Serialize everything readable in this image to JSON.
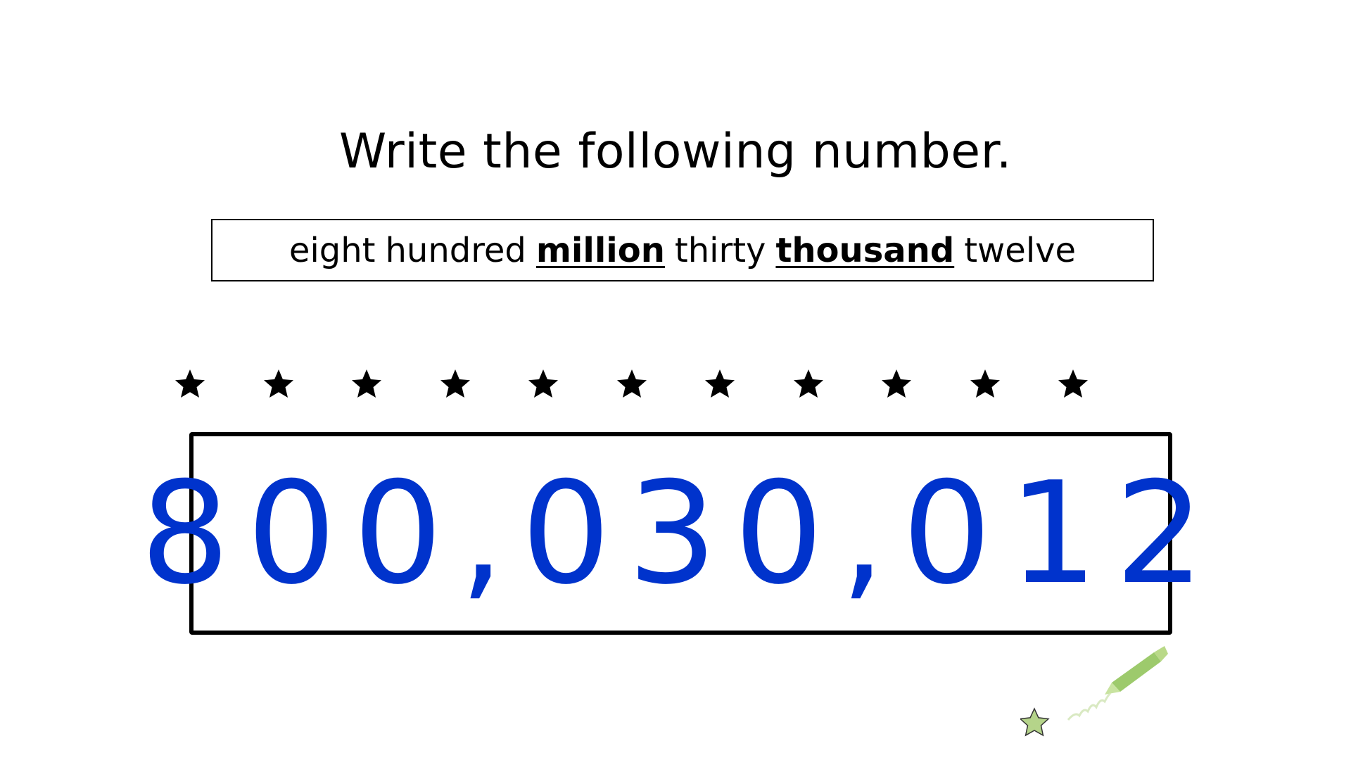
{
  "heading": "Write the following number.",
  "prompt": {
    "words": [
      {
        "text": "eight",
        "emphasis": false
      },
      {
        "text": "hundred",
        "emphasis": false
      },
      {
        "text": "million",
        "emphasis": true
      },
      {
        "text": "thirty",
        "emphasis": false
      },
      {
        "text": "thousand",
        "emphasis": true
      },
      {
        "text": "twelve",
        "emphasis": false
      }
    ]
  },
  "star_row": {
    "count": 11,
    "icon": "star-icon",
    "color": "#000000"
  },
  "answer": {
    "value": "800,030,012",
    "color": "#0033cc"
  },
  "decoration": {
    "icon": "star-pen-icon",
    "star_color": "#b5d48a",
    "pen_color": "#8cc152"
  }
}
